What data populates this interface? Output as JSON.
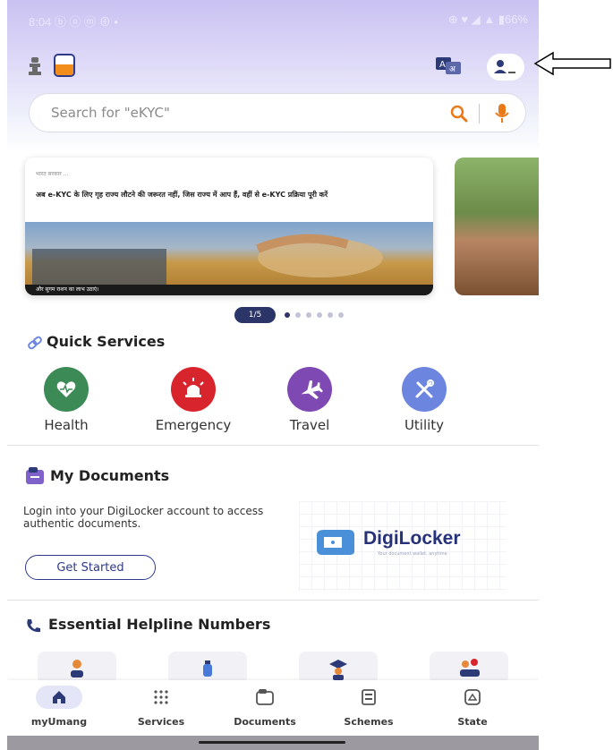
{
  "status_bar": {
    "time": "8:04 ⓑ ⓞ ⓜ ⊕ •",
    "right": "⊕ ♥ ◢ ▲ ▮66%"
  },
  "search": {
    "placeholder": "Search for \"eKYC\""
  },
  "banner": {
    "gov_line": "भारत सरकार ...",
    "text": "अब e-KYC के लिए गृह राज्य लौटने की जरूरत नहीं, जिस राज्य में आप हैं, वहीं से e-KYC प्रक्रिया पूरी करें",
    "caption": "और सुगम राशन का लाभ उठाएं।",
    "page_indicator": "1/5"
  },
  "quick_services": {
    "title": "Quick Services",
    "items": [
      {
        "label": "Health",
        "color": "#3c8a56",
        "icon": "heart-icon"
      },
      {
        "label": "Emergency",
        "color": "#d8252d",
        "icon": "siren-icon"
      },
      {
        "label": "Travel",
        "color": "#7f49b3",
        "icon": "airplane-icon"
      },
      {
        "label": "Utility",
        "color": "#6c86e0",
        "icon": "tools-icon"
      }
    ]
  },
  "my_documents": {
    "title": "My Documents",
    "description": "Login into your DigiLocker account to access authentic documents.",
    "button": "Get Started",
    "brand": "DigiLocker",
    "brand_tagline": "Your document wallet, anytime"
  },
  "helpline": {
    "title": "Essential Helpline Numbers"
  },
  "bottom_nav": [
    {
      "label": "myUmang",
      "icon": "home-icon",
      "active": true
    },
    {
      "label": "Services",
      "icon": "grid-icon",
      "active": false
    },
    {
      "label": "Documents",
      "icon": "documents-icon",
      "active": false
    },
    {
      "label": "Schemes",
      "icon": "schemes-icon",
      "active": false
    },
    {
      "label": "State",
      "icon": "state-map-icon",
      "active": false
    }
  ],
  "colors": {
    "accent": "#2f3a8a",
    "brand_orange": "#f28c1b"
  }
}
